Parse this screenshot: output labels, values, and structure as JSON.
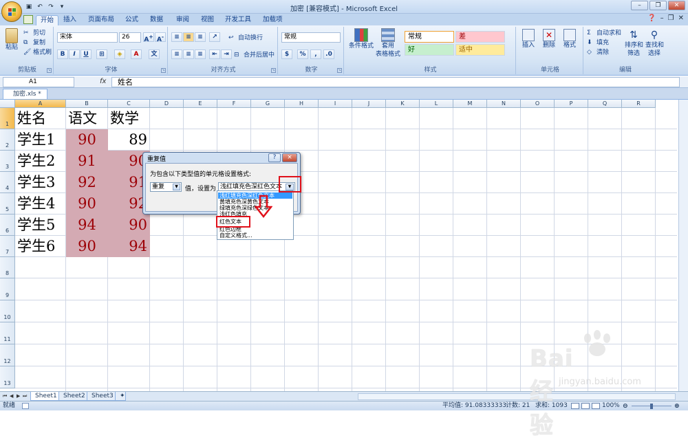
{
  "window": {
    "title": "加密  [兼容模式] - Microsoft Excel"
  },
  "ribbon_tabs": [
    "开始",
    "插入",
    "页面布局",
    "公式",
    "数据",
    "审阅",
    "视图",
    "开发工具",
    "加载项"
  ],
  "clipboard": {
    "paste": "粘贴",
    "cut": "剪切",
    "copy": "复制",
    "format_painter": "格式刷",
    "label": "剪贴板"
  },
  "font": {
    "name": "宋体",
    "size": "26",
    "label": "字体"
  },
  "alignment": {
    "wrap": "自动换行",
    "merge": "合并后居中",
    "label": "对齐方式"
  },
  "number": {
    "format": "常规",
    "label": "数字"
  },
  "styles": {
    "conditional": "条件格式",
    "table_format_1": "套用",
    "table_format_2": "表格格式",
    "normal": "常规",
    "bad": "差",
    "good": "好",
    "neutral": "适中",
    "label": "样式"
  },
  "cells": {
    "insert": "插入",
    "delete": "删除",
    "format": "格式",
    "label": "单元格"
  },
  "editing": {
    "autosum": "自动求和",
    "fill": "填充",
    "clear": "清除",
    "sort_1": "排序和",
    "sort_2": "筛选",
    "find_1": "查找和",
    "find_2": "选择",
    "label": "编辑"
  },
  "formula_bar": {
    "name_box": "A1",
    "fx": "fx",
    "content": "姓名"
  },
  "workbook_tab": "加密.xls *",
  "columns": [
    "A",
    "B",
    "C",
    "D",
    "E",
    "F",
    "G",
    "H",
    "I",
    "J",
    "K",
    "L",
    "M",
    "N",
    "O",
    "P",
    "Q",
    "R"
  ],
  "rows": [
    "1",
    "2",
    "3",
    "4",
    "5",
    "6",
    "7",
    "8",
    "9",
    "10",
    "11",
    "12",
    "13"
  ],
  "sheet": {
    "header": [
      "姓名",
      "语文",
      "数学"
    ],
    "students": [
      {
        "name": "学生1",
        "chinese": "90",
        "math": "89"
      },
      {
        "name": "学生2",
        "chinese": "91",
        "math": "90"
      },
      {
        "name": "学生3",
        "chinese": "92",
        "math": "91"
      },
      {
        "name": "学生4",
        "chinese": "90",
        "math": "92"
      },
      {
        "name": "学生5",
        "chinese": "94",
        "math": "90"
      },
      {
        "name": "学生6",
        "chinese": "90",
        "math": "94"
      }
    ]
  },
  "sheet_tabs": [
    "Sheet1",
    "Sheet2",
    "Sheet3"
  ],
  "status": {
    "ready": "就绪",
    "average": "平均值: 91.08333333",
    "count": "计数: 21",
    "sum": "求和: 1093",
    "zoom": "100%"
  },
  "dialog": {
    "title": "重复值",
    "help": "?",
    "close": "×",
    "prompt": "为包含以下类型值的单元格设置格式:",
    "type_value": "重复",
    "mid_text": "值，设置为",
    "format_value": "浅红填充色深红色文本",
    "options": [
      "浅红填充色深红色文本",
      "黄填充色深黄色文本",
      "绿填充色深绿色文本",
      "浅红色填充",
      "红色文本",
      "红色边框",
      "自定义格式..."
    ],
    "selected_index": 0
  },
  "watermark": {
    "brand": "Bai 经验",
    "url": "jingyan.baidu.com"
  },
  "colors": {
    "duplicate_fill": "#d4aab3",
    "duplicate_text": "#9c0006",
    "annotation": "#e0101a"
  }
}
